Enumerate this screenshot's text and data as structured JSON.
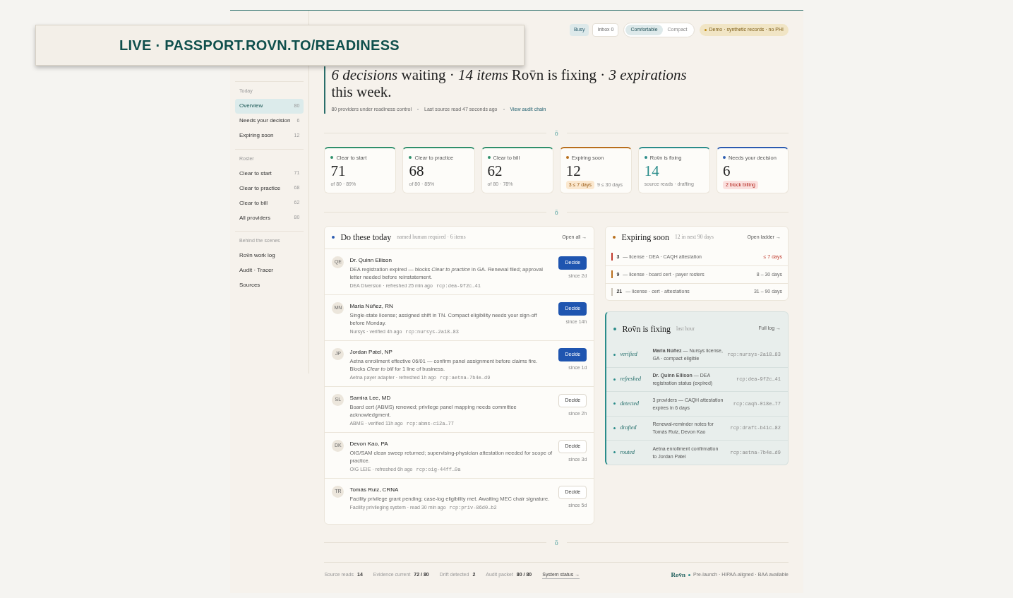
{
  "overlay_label": "LIVE · PASSPORT.ROVN.TO/READINESS",
  "topbar": {
    "status_chips": [
      {
        "label": "Busy",
        "selected": true
      },
      {
        "label": "Inbox 0",
        "selected": false
      }
    ],
    "density": [
      {
        "label": "Comfortable",
        "selected": true
      },
      {
        "label": "Compact",
        "selected": false
      }
    ],
    "demo_badge": "Demo · synthetic records · no PHI"
  },
  "headline": "*6 decisions* waiting · *14 items* Rov̄n is fixing · *3 expirations* this week.",
  "meta": [
    "80 providers under readiness control",
    "Last source read 47 seconds ago"
  ],
  "audit_link": "View audit chain",
  "sidebar": [
    {
      "title": "Today",
      "items": [
        {
          "label": "Overview",
          "count": "80",
          "selected": true
        },
        {
          "label": "Needs your decision",
          "count": "6",
          "selected": false
        },
        {
          "label": "Expiring soon",
          "count": "12",
          "selected": false
        }
      ]
    },
    {
      "title": "Roster",
      "items": [
        {
          "label": "Clear to start",
          "count": "71",
          "selected": false
        },
        {
          "label": "Clear to practice",
          "count": "68",
          "selected": false
        },
        {
          "label": "Clear to bill",
          "count": "62",
          "selected": false
        },
        {
          "label": "All providers",
          "count": "80",
          "selected": false
        }
      ]
    },
    {
      "title": "Behind the scenes",
      "items": [
        {
          "label": "Rov̄n work log",
          "selected": false
        },
        {
          "label": "Audit · Tracer",
          "selected": false
        },
        {
          "label": "Sources",
          "selected": false
        }
      ]
    }
  ],
  "dividers": [
    "ō",
    "ō",
    "ō"
  ],
  "stats": [
    {
      "label": "Clear to start",
      "value": "71",
      "kind": "plain",
      "sub": "of 80 · 89%",
      "color": "#2f8f6b"
    },
    {
      "label": "Clear to practice",
      "value": "68",
      "kind": "plain",
      "sub": "of 80 · 85%",
      "color": "#2f8f6b"
    },
    {
      "label": "Clear to bill",
      "value": "62",
      "kind": "plain",
      "sub": "of 80 · 78%",
      "color": "#2f8f6b"
    },
    {
      "label": "Expiring soon",
      "value": "12",
      "kind": "chips",
      "chip": "3 ≤ 7 days",
      "sub": "9 ≤ 30 days",
      "color": "#b86e1c"
    },
    {
      "label": "Rov̄n is fixing",
      "value": "14",
      "kind": "plain",
      "sub": "source reads · drafting",
      "color": "#2a8c8a"
    },
    {
      "label": "Needs your decision",
      "value": "6",
      "kind": "alert",
      "chip": "2 block billing",
      "color": "#2b5bb0"
    }
  ],
  "today": {
    "title": "Do these today",
    "subtitle": "named human required · 6 items",
    "link": "Open all →",
    "items": [
      {
        "initials": "QE",
        "name": "Dr. Quinn Ellison",
        "body": "DEA registration expired — blocks *Clear to practice* in GA. Renewal filed; approval letter needed before reinstatement.",
        "source": "DEA Diversion · refreshed 25 min ago",
        "receipt": "rcp:dea-9f2c…41",
        "button": "Decide",
        "primary": true,
        "since": "since 2d"
      },
      {
        "initials": "MN",
        "name": "Maria Núñez, RN",
        "body": "Single-state license; assigned shift in TN. Compact eligibility needs your sign-off before Monday.",
        "source": "Nursys · verified 4h ago",
        "receipt": "rcp:nursys-2a18…83",
        "button": "Decide",
        "primary": true,
        "since": "since 14h"
      },
      {
        "initials": "JP",
        "name": "Jordan Patel, NP",
        "body": "Aetna enrollment effective 06/01 — confirm panel assignment before claims fire. Blocks *Clear to bill* for 1 line of business.",
        "source": "Aetna payer adapter · refreshed 1h ago",
        "receipt": "rcp:aetna-7b4e…d9",
        "button": "Decide",
        "primary": true,
        "since": "since 1d"
      },
      {
        "initials": "SL",
        "name": "Samira Lee, MD",
        "body": "Board cert (ABMS) renewed; privilege panel mapping needs committee acknowledgment.",
        "source": "ABMS · verified 11h ago",
        "receipt": "rcp:abms-c12a…77",
        "button": "Decide",
        "primary": false,
        "since": "since 2h"
      },
      {
        "initials": "DK",
        "name": "Devon Kao, PA",
        "body": "OIG/SAM clean sweep returned; supervising-physician attestation needed for scope of practice.",
        "source": "OIG LEIE · refreshed 6h ago",
        "receipt": "rcp:oig-44ff…0a",
        "button": "Decide",
        "primary": false,
        "since": "since 3d"
      },
      {
        "initials": "TR",
        "name": "Tomás Ruiz, CRNA",
        "body": "Facility privilege grant pending; case-log eligibility met. Awaiting MEC chair signature.",
        "source": "Facility privileging system · read 30 min ago",
        "receipt": "rcp:priv-86d0…b2",
        "button": "Decide",
        "primary": false,
        "since": "since 5d"
      }
    ]
  },
  "expiring": {
    "title": "Expiring soon",
    "subtitle": "12 in next 90 days",
    "link": "Open ladder →",
    "rows": [
      {
        "count": "3",
        "text": "— license · DEA · CAQH attestation",
        "range": "≤ 7 days",
        "color": "#c0392b",
        "urgent": true
      },
      {
        "count": "9",
        "text": "— license · board cert · payer rosters",
        "range": "8 – 30 days",
        "color": "#b86e1c",
        "urgent": false
      },
      {
        "count": "21",
        "text": "— license · cert · attestations",
        "range": "31 – 90 days",
        "color": "#c9c2b6",
        "urgent": false
      }
    ]
  },
  "fixing": {
    "title": "Rov̄n is fixing",
    "subtitle": "last hour",
    "link": "Full log →",
    "rows": [
      {
        "verb": "verified",
        "text": "**Maria Núñez** — Nursys license, GA · compact eligible",
        "receipt": "rcp:nursys-2a18…83"
      },
      {
        "verb": "refreshed",
        "text": "**Dr. Quinn Ellison** — DEA registration status (expired)",
        "receipt": "rcp:dea-9f2c…41"
      },
      {
        "verb": "detected",
        "text": "3 providers — CAQH attestation expires in 6 days",
        "receipt": "rcp:caqh-018e…77"
      },
      {
        "verb": "drafted",
        "text": "Renewal-reminder notes for Tomás Ruiz, Devon Kao",
        "receipt": "rcp:draft-b41c…82"
      },
      {
        "verb": "routed",
        "text": "Aetna enrollment confirmation to Jordan Patel",
        "receipt": "rcp:aetna-7b4e…d9"
      }
    ]
  },
  "footer": {
    "stats": [
      {
        "label": "Source reads",
        "value": "14"
      },
      {
        "label": "Evidence current",
        "value": "72 / 80"
      },
      {
        "label": "Drift detected",
        "value": "2"
      },
      {
        "label": "Audit packet",
        "value": "80 / 80"
      }
    ],
    "link": "System status →",
    "brand": "Rov̄n",
    "note": "Pre-launch · HIPAA-aligned · BAA available"
  }
}
